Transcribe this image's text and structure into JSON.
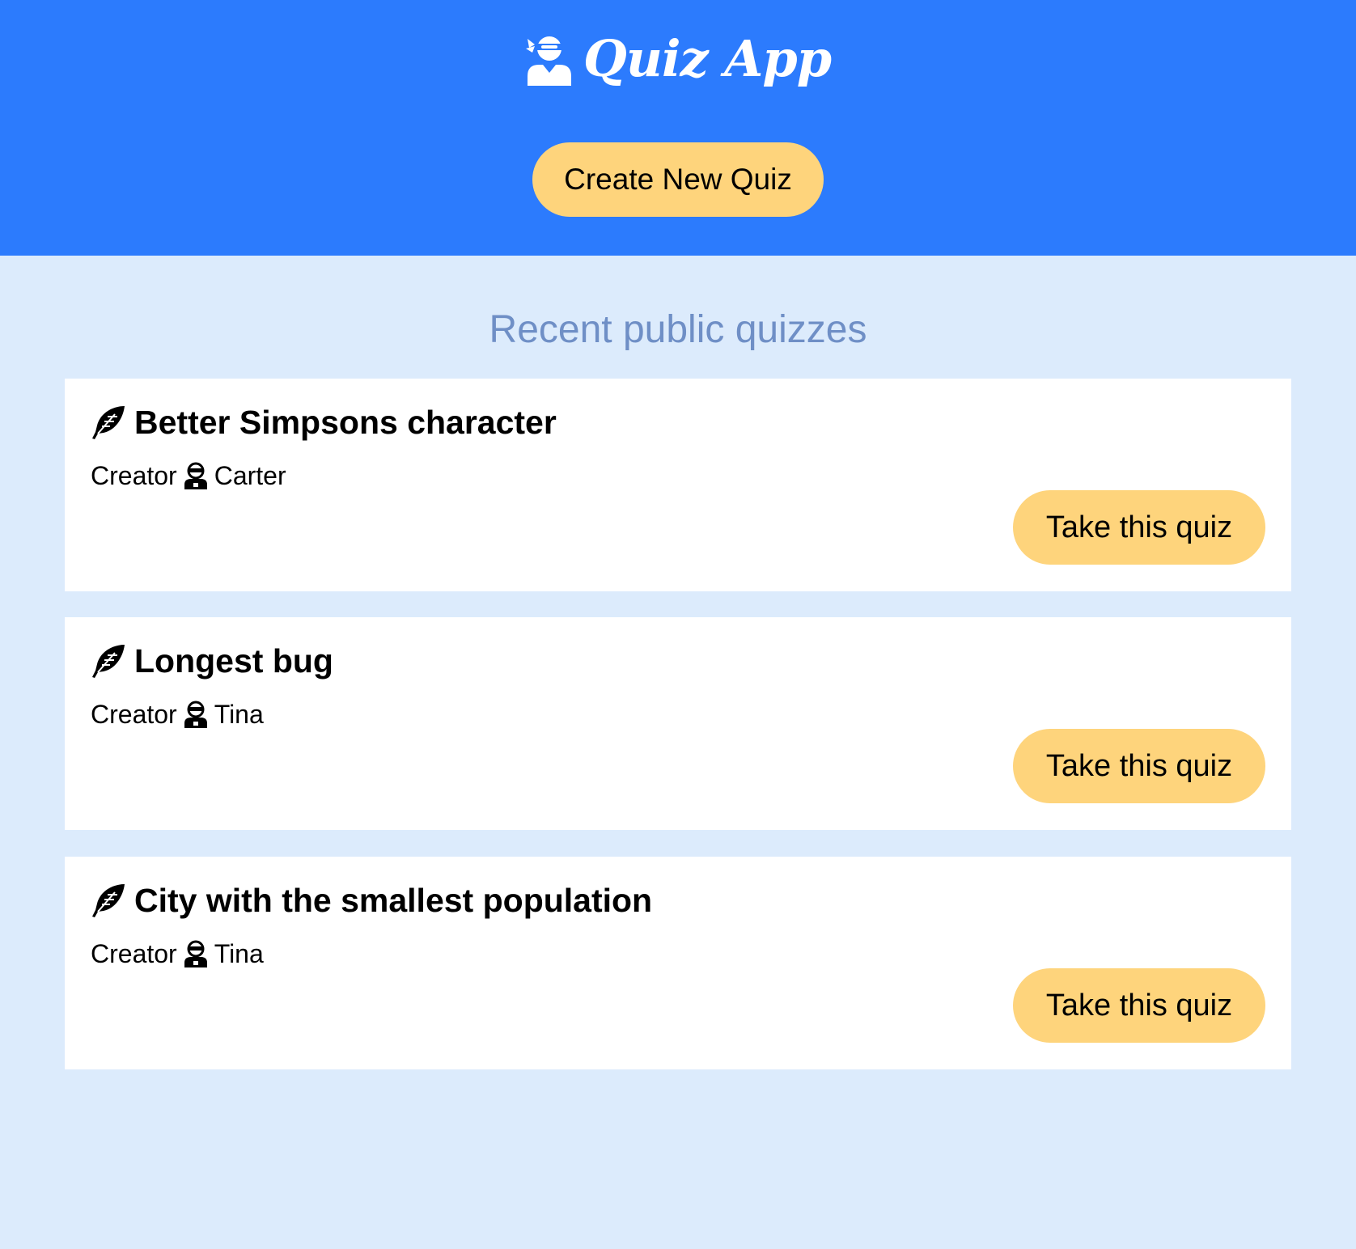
{
  "header": {
    "app_title": "Quiz App",
    "logo_icon": "ninja-user-icon",
    "create_button_label": "Create New Quiz",
    "background_color": "#2c7bfd"
  },
  "main": {
    "section_title": "Recent public quizzes",
    "background_color": "#dcebfc",
    "quizzes": [
      {
        "title": "Better Simpsons character",
        "creator_label": "Creator",
        "creator_name": "Carter",
        "take_button_label": "Take this quiz"
      },
      {
        "title": "Longest bug",
        "creator_label": "Creator",
        "creator_name": "Tina",
        "take_button_label": "Take this quiz"
      },
      {
        "title": "City with the smallest population",
        "creator_label": "Creator",
        "creator_name": "Tina",
        "take_button_label": "Take this quiz"
      }
    ]
  },
  "colors": {
    "accent_button": "#fed47c",
    "section_title": "#6f8fc6",
    "card_background": "#ffffff"
  }
}
